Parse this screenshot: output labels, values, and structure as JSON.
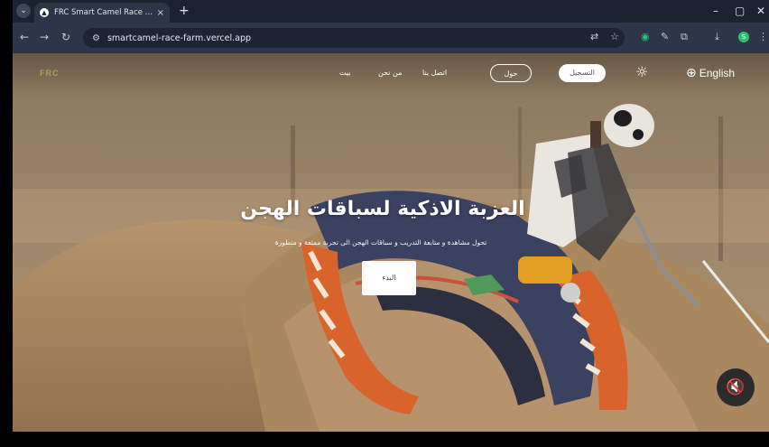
{
  "browser": {
    "tab": {
      "title": "FRC Smart Camel Race Farm",
      "close": "×",
      "favicon": "▲"
    },
    "tab_menu": "⌄",
    "new_tab": "+",
    "window_controls": {
      "minimize": "–",
      "restore": "▢",
      "close": "✕"
    },
    "nav": {
      "back": "←",
      "forward": "→",
      "reload": "↻"
    },
    "omnibox": {
      "site_info": "⚙",
      "url": "smartcamel-race-farm.vercel.app"
    },
    "toolbar_icons": {
      "translate": "⇄",
      "bookmark": "☆",
      "extension_green": "◉",
      "pen": "✎",
      "extensions": "⧉",
      "download": "⤓"
    },
    "profile_initial": "S",
    "menu": "⋮"
  },
  "site": {
    "logo_text": "FRC",
    "nav": {
      "links": [
        "بيت",
        "من نحن",
        "اتصل بنا"
      ],
      "about_button": "حول",
      "register_button": "التسجيل",
      "theme_icon": "☼",
      "language": {
        "globe_icon": "⊕",
        "label": "English"
      }
    },
    "hero": {
      "title": "العزبة الاذكية لسباقات الهجن",
      "subtitle": "تحول مشاهدة و متابعة التدريب و سباقات الهجن الى تجربة ممتعة و متطورة",
      "cta": "البدء"
    },
    "mute_icon": "🔇"
  },
  "colors": {
    "tabstrip": "#1b2330",
    "toolbar": "#2c3646",
    "accent_green": "#2fbf71",
    "saddle_orange": "#d8642c"
  }
}
